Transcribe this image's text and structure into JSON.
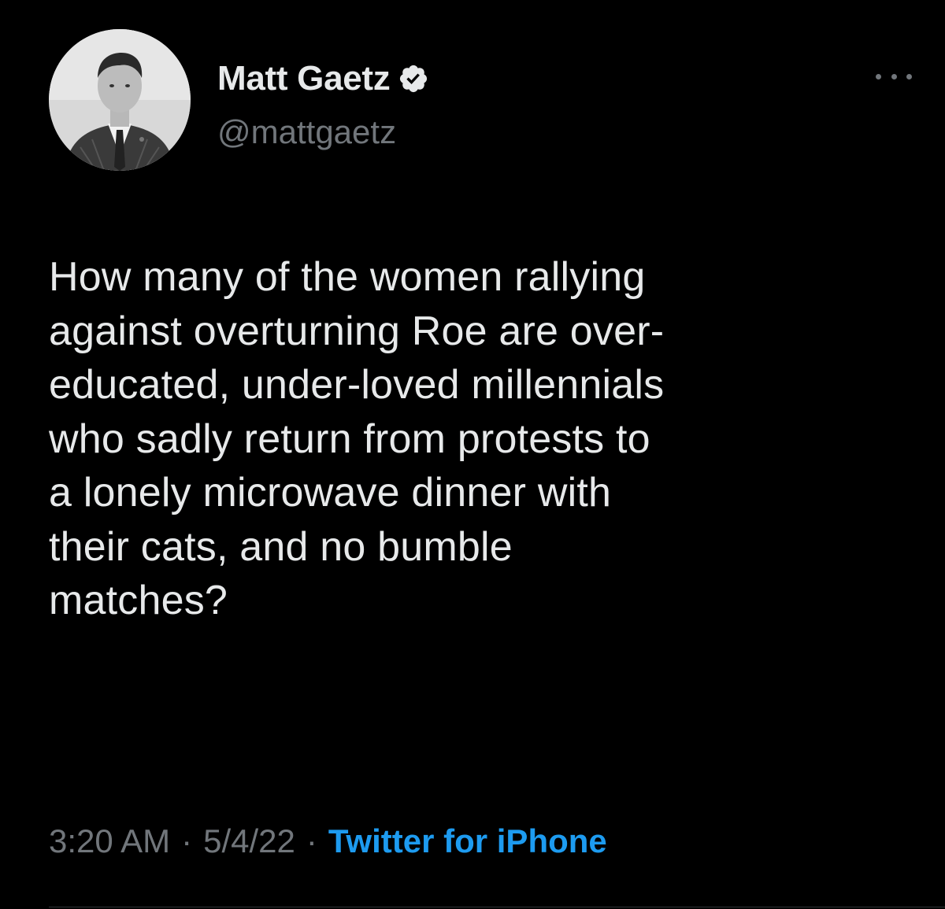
{
  "author": {
    "display_name": "Matt Gaetz",
    "handle": "@mattgaetz",
    "verified": true,
    "avatar_icon": "profile-photo"
  },
  "tweet": {
    "text": "How many of the women rallying\nagainst overturning Roe are over-\neducated, under-loved millennials\nwho sadly return from protests to\na lonely microwave dinner with\ntheir cats, and no bumble\nmatches?"
  },
  "meta": {
    "time": "3:20 AM",
    "separator": "·",
    "date": "5/4/22",
    "source": "Twitter for iPhone"
  },
  "icons": {
    "more": "more-options-icon",
    "verified": "verified-badge-icon"
  },
  "colors": {
    "background": "#000000",
    "text": "#e7e9ea",
    "secondary": "#71767b",
    "accent": "#1d9bf0"
  }
}
